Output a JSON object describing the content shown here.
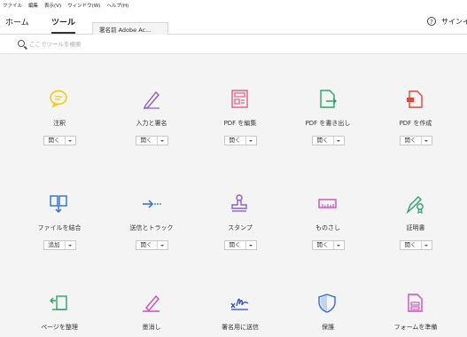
{
  "menu": [
    "ファイル",
    "編集",
    "表示(V)",
    "ウィンドウ(W)",
    "ヘルプ(H)"
  ],
  "tabs": {
    "home": "ホーム",
    "tools": "ツール",
    "document": "署名前 Adobe Ac..."
  },
  "header": {
    "help_glyph": "?",
    "signin": "サインイン"
  },
  "search": {
    "placeholder": "ここでツールを検索"
  },
  "tools": [
    {
      "label": "注釈",
      "button": "開く",
      "icon": "comment-icon",
      "color": "#f2c600"
    },
    {
      "label": "入力と署名",
      "button": "開く",
      "icon": "fill-sign-icon",
      "color": "#8a5fd1"
    },
    {
      "label": "PDF を編集",
      "button": "開く",
      "icon": "edit-pdf-icon",
      "color": "#e05b8a"
    },
    {
      "label": "PDF を書き出し",
      "button": "開く",
      "icon": "export-pdf-icon",
      "color": "#2fa36b"
    },
    {
      "label": "PDF を作成",
      "button": "開く",
      "icon": "create-pdf-icon",
      "color": "#e4453d"
    },
    {
      "label": "ファイルを結合",
      "button": "追加",
      "icon": "combine-files-icon",
      "color": "#2b6fd6"
    },
    {
      "label": "送信とトラック",
      "button": "開く",
      "icon": "send-track-icon",
      "color": "#2b6fd6"
    },
    {
      "label": "スタンプ",
      "button": "開く",
      "icon": "stamp-icon",
      "color": "#8a5fd1"
    },
    {
      "label": "ものさし",
      "button": "開く",
      "icon": "ruler-icon",
      "color": "#cc4fb8"
    },
    {
      "label": "証明書",
      "button": "開く",
      "icon": "certificate-icon",
      "color": "#2fa36b"
    },
    {
      "label": "ページを整理",
      "button": "",
      "icon": "organize-pages-icon",
      "color": "#2fa36b"
    },
    {
      "label": "墨消し",
      "button": "",
      "icon": "redact-icon",
      "color": "#cc4fb8"
    },
    {
      "label": "署名用に送信",
      "button": "",
      "icon": "send-for-signature-icon",
      "color": "#2b4fb0"
    },
    {
      "label": "保護",
      "button": "",
      "icon": "protect-icon",
      "color": "#2b6fd6"
    },
    {
      "label": "フォームを準備",
      "button": "",
      "icon": "prepare-form-icon",
      "color": "#cc4fb8"
    }
  ]
}
